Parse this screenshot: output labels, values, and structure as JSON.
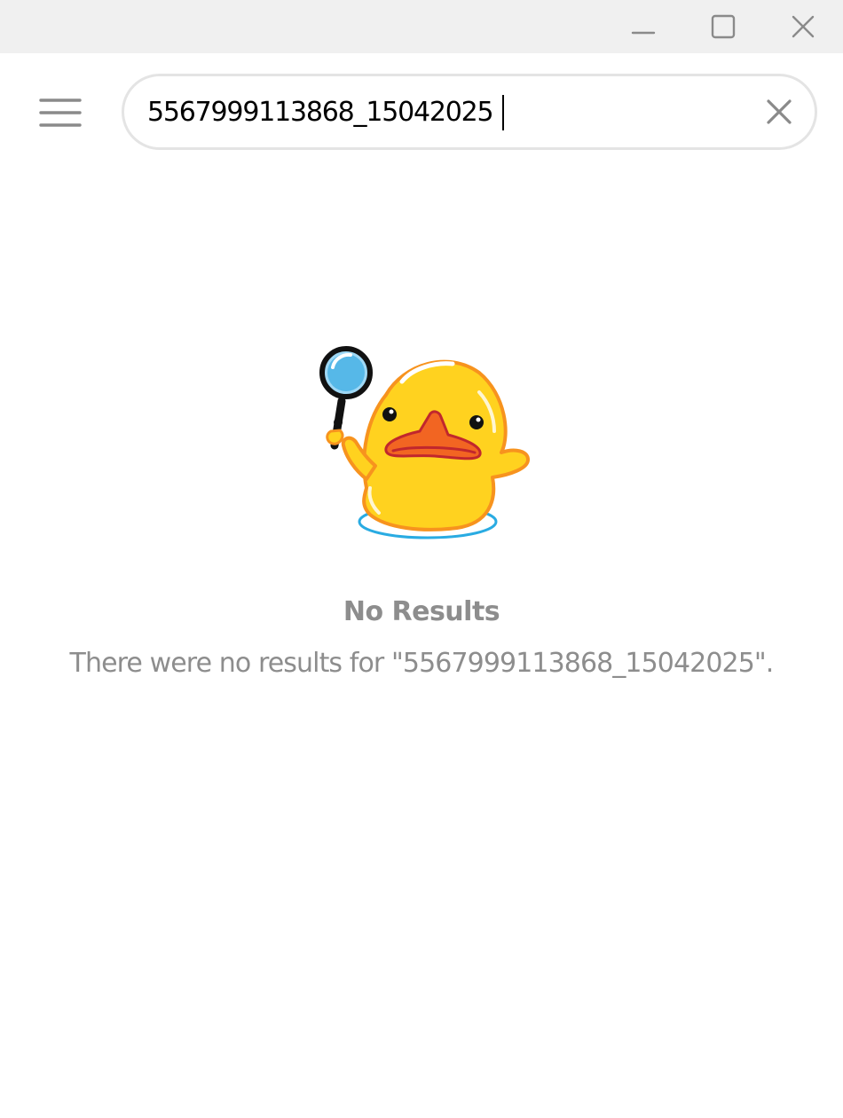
{
  "window": {
    "controls": {
      "minimize_icon": "minimize-icon",
      "maximize_icon": "maximize-icon",
      "close_icon": "close-icon"
    },
    "titlebar_color": "#f0f0f0"
  },
  "header": {
    "menu_icon": "hamburger-menu-icon",
    "search": {
      "value": "5567999113868_15042025",
      "clear_icon": "clear-x-icon"
    }
  },
  "empty_state": {
    "illustration": "duck-with-magnifying-glass",
    "title": "No Results",
    "message": "There were no results for \"5567999113868_15042025\"."
  },
  "colors": {
    "secondary_text": "#8d8d8d",
    "search_border": "#e4e4e4",
    "duck_yellow": "#ffd21f",
    "duck_orange": "#f7931e"
  }
}
